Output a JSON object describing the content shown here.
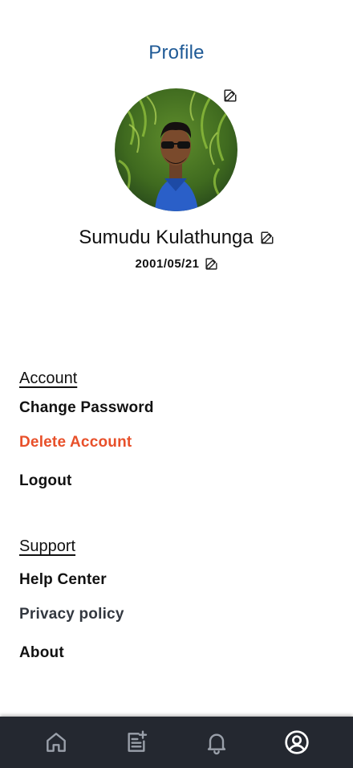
{
  "header": {
    "title": "Profile"
  },
  "profile": {
    "name": "Sumudu Kulathunga",
    "dob": "2001/05/21"
  },
  "account": {
    "heading": "Account",
    "items": [
      "Change Password",
      "Delete Account",
      "Logout"
    ]
  },
  "support": {
    "heading": "Support",
    "items": [
      "Help Center",
      "Privacy policy",
      "About"
    ]
  },
  "nav": {
    "items": [
      "home-icon",
      "note-add-icon",
      "bell-icon",
      "account-circle-icon"
    ],
    "active": "account-circle-icon"
  },
  "colors": {
    "title": "#1f5a96",
    "danger": "#e8502a",
    "nav_bg": "#242830",
    "nav_icon": "#9aa0aa",
    "nav_active": "#ffffff"
  }
}
